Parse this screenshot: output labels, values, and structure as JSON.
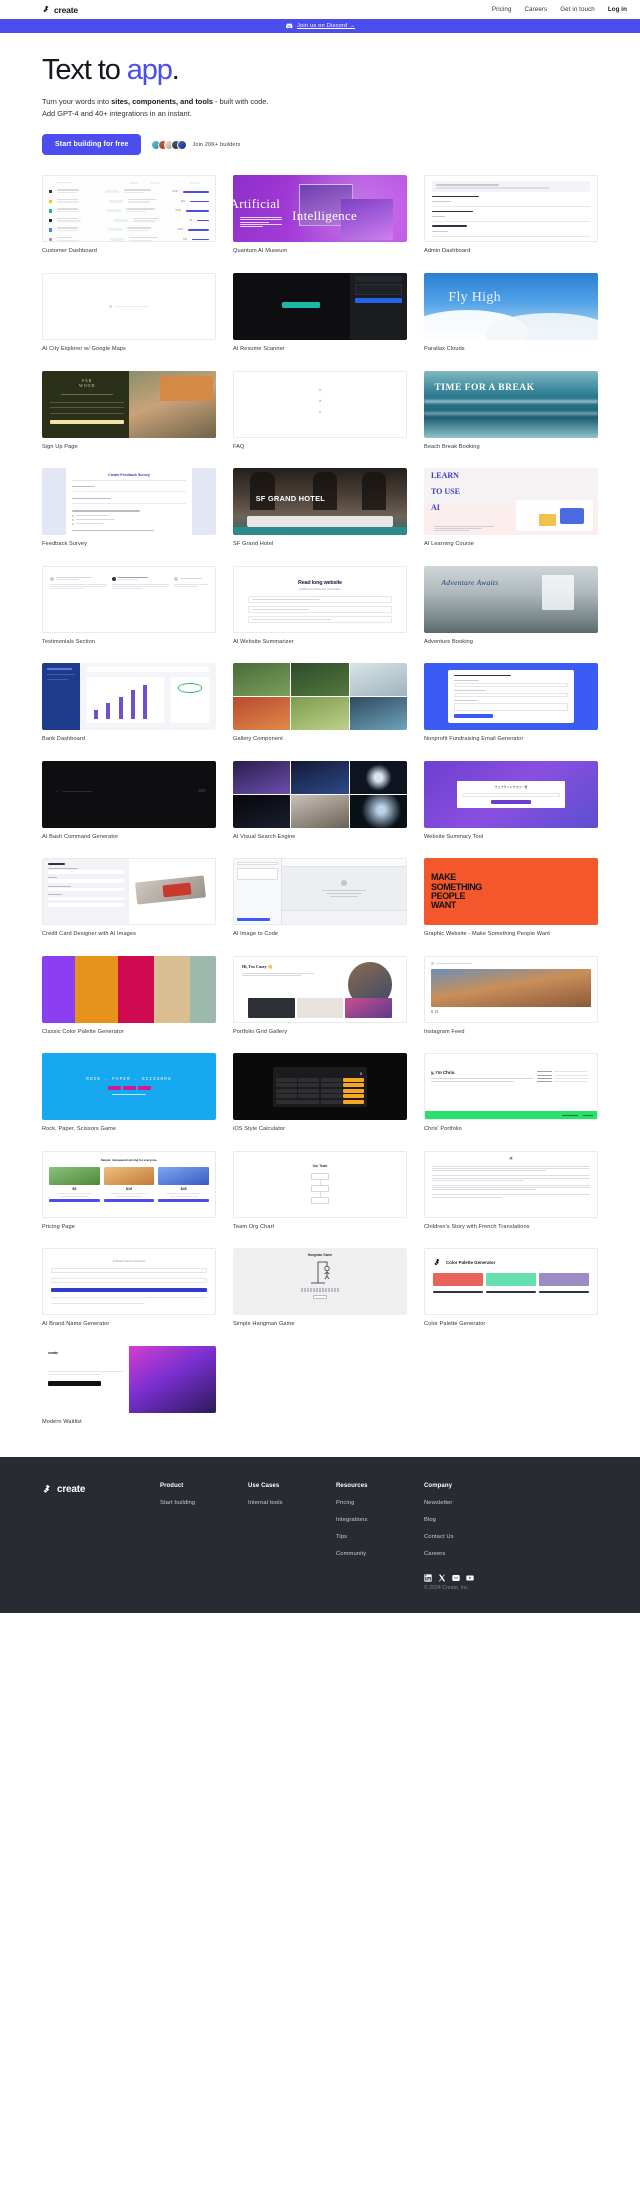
{
  "brand": {
    "name": "create",
    "icon": "create-logo-icon"
  },
  "nav": {
    "links": [
      {
        "label": "Pricing",
        "name": "nav-link-pricing"
      },
      {
        "label": "Careers",
        "name": "nav-link-careers"
      },
      {
        "label": "Get in touch",
        "name": "nav-link-get-in-touch"
      },
      {
        "label": "Log in",
        "name": "nav-link-login"
      }
    ]
  },
  "announcement": {
    "text": "Join us on Discord →",
    "icon": "discord-icon",
    "bg": "#4b4dee"
  },
  "hero": {
    "title_lead": "Text to ",
    "title_accent": "app",
    "title_period": ".",
    "accent_color": "#4b4dee",
    "subtitle_a": "Turn your words into ",
    "subtitle_bold": "sites, components, and tools",
    "subtitle_b": " - built with code.",
    "subtitle_line2": "Add GPT-4 and 40+ integrations in an instant.",
    "cta_label": "Start building for free",
    "social_proof": "Join 20K+ builders"
  },
  "gallery": {
    "cards": [
      {
        "label": "Customer Dashboard",
        "art": "table-list"
      },
      {
        "label": "Quantum AI Museum",
        "art": "purple-ai"
      },
      {
        "label": "Admin Dashboard",
        "art": "admin-form"
      },
      {
        "label": "AI City Explorer w/ Google Maps",
        "art": "blank-center"
      },
      {
        "label": "AI Resume Scanner",
        "art": "dark-scanner"
      },
      {
        "label": "Parallax Clouds",
        "art": "fly-high"
      },
      {
        "label": "Sign Up Page",
        "art": "signup-split"
      },
      {
        "label": "FAQ",
        "art": "faq-list"
      },
      {
        "label": "Beach Break Booking",
        "art": "beach-break"
      },
      {
        "label": "Feedback Survey",
        "art": "feedback-survey"
      },
      {
        "label": "SF Grand Hotel",
        "art": "sf-hotel"
      },
      {
        "label": "AI Learning Course",
        "art": "learn-use"
      },
      {
        "label": "Testimonials Section",
        "art": "testimonials"
      },
      {
        "label": "AI Website Summarizer",
        "art": "read-long-website"
      },
      {
        "label": "Adventure Booking",
        "art": "adventure-awaits"
      },
      {
        "label": "Bank Dashboard",
        "art": "bank-dashboard"
      },
      {
        "label": "Gallery Component",
        "art": "gallery-grid"
      },
      {
        "label": "Nonprofit Fundraising Email Generator",
        "art": "blue-email"
      },
      {
        "label": "AI Bash Command Generator",
        "art": "terminal"
      },
      {
        "label": "AI Visual Search Engine",
        "art": "visual-search"
      },
      {
        "label": "Website Summary Tool",
        "art": "jp-summary"
      },
      {
        "label": "Credit Card Designer with AI Images",
        "art": "credit-card"
      },
      {
        "label": "AI Image to Code",
        "art": "image-to-code"
      },
      {
        "label": "Graphic Website - Make Something People Want",
        "art": "orange-poster"
      },
      {
        "label": "Classic Color Palette Generator",
        "art": "palette-bars"
      },
      {
        "label": "Portfolio Grid Gallery",
        "art": "casey-portfolio"
      },
      {
        "label": "Instagram Feed",
        "art": "instagram-feed"
      },
      {
        "label": "Rock, Paper, Scissors Game",
        "art": "rps-game"
      },
      {
        "label": "iOS Style Calculator",
        "art": "ios-calculator"
      },
      {
        "label": "Chris' Portfolio",
        "art": "chris-portfolio"
      },
      {
        "label": "Pricing Page",
        "art": "pricing-page"
      },
      {
        "label": "Team Org Chart",
        "art": "org-chart"
      },
      {
        "label": "Children's Story with French Translations",
        "art": "french-story"
      },
      {
        "label": "AI Brand Name Generator",
        "art": "brand-name"
      },
      {
        "label": "Simple Hangman Game",
        "art": "hangman"
      },
      {
        "label": "Color Palette Generator",
        "art": "color-palette-gen"
      },
      {
        "label": "Modern Waitlist",
        "art": "modern-waitlist"
      }
    ]
  },
  "gallery_inline": {
    "quantum_word_a": "Artificial",
    "quantum_word_b": "Intelligence",
    "fly_high": "Fly High",
    "time_for_break": "TIME FOR A BREAK",
    "feedback_title": "Create Feedback Survey",
    "sf_hotel": "SF GRAND HOTEL",
    "learn_1": "LEARN",
    "learn_2": "TO USE",
    "learn_3": "AI",
    "read_long": "Read long website",
    "read_long_sub": "Quickly summarize any web content",
    "adventure": "Adventure Awaits",
    "poster_1": "MAKE",
    "poster_2": "SOMETHING",
    "poster_3": "PEOPLE",
    "poster_4": "WANT",
    "casey": "Hi, I'm Casey 👋",
    "rps": "ROCK . PAPER . SCISSORS",
    "calc_display": "0",
    "chris": "y, I'm Chris.",
    "pricing_head": "Simple, transparent pricing for everyone.",
    "pricing_tiers": [
      "$9",
      "$19",
      "$49"
    ],
    "org_title": "Our Team",
    "hangman_title": "Hangman Game",
    "palette_gen_title": "Color Palette Generator",
    "waitlist_brand": "create"
  },
  "footer": {
    "brand": "create",
    "columns": [
      {
        "title": "Product",
        "links": [
          "Start building"
        ]
      },
      {
        "title": "Use Cases",
        "links": [
          "Internal tools"
        ]
      },
      {
        "title": "Resources",
        "links": [
          "Pricing",
          "Integrations",
          "Tips",
          "Community"
        ]
      },
      {
        "title": "Company",
        "links": [
          "Newsletter",
          "Blog",
          "Contact Us",
          "Careers"
        ]
      }
    ],
    "socials": [
      "linkedin-icon",
      "x-twitter-icon",
      "discord-icon",
      "youtube-icon"
    ],
    "copyright": "© 2024 Create, Inc."
  }
}
